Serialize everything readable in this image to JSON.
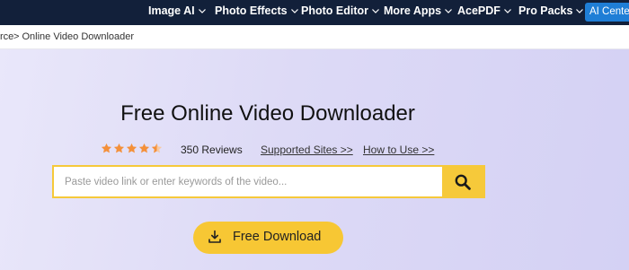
{
  "nav": {
    "items": [
      {
        "label": "Image AI"
      },
      {
        "label": "Photo Effects"
      },
      {
        "label": "Photo Editor"
      },
      {
        "label": "More Apps"
      },
      {
        "label": "AcePDF"
      },
      {
        "label": "Pro Packs"
      }
    ],
    "ai_center_label": "AI Center",
    "chevron_icon": "chevron-down-icon"
  },
  "breadcrumb": {
    "prev": "rce",
    "current": "> Online Video Downloader"
  },
  "hero": {
    "title": "Free Online Video Downloader",
    "rating": {
      "stars": 4.5,
      "star_color": "#f4903a"
    },
    "reviews": "350 Reviews",
    "supported_sites": "Supported Sites >>",
    "how_to_use": "How to Use >>"
  },
  "search": {
    "placeholder": "Paste video link or enter keywords of the video...",
    "value": "",
    "button_icon": "search-icon",
    "accent": "#f6c93a"
  },
  "download": {
    "label": "Free Download",
    "icon": "download-icon"
  },
  "colors": {
    "nav_bg": "#12203a",
    "ai_center_bg": "#1f7ed6",
    "hero_bg": "#dddaf6",
    "button_yellow": "#f7c734"
  }
}
